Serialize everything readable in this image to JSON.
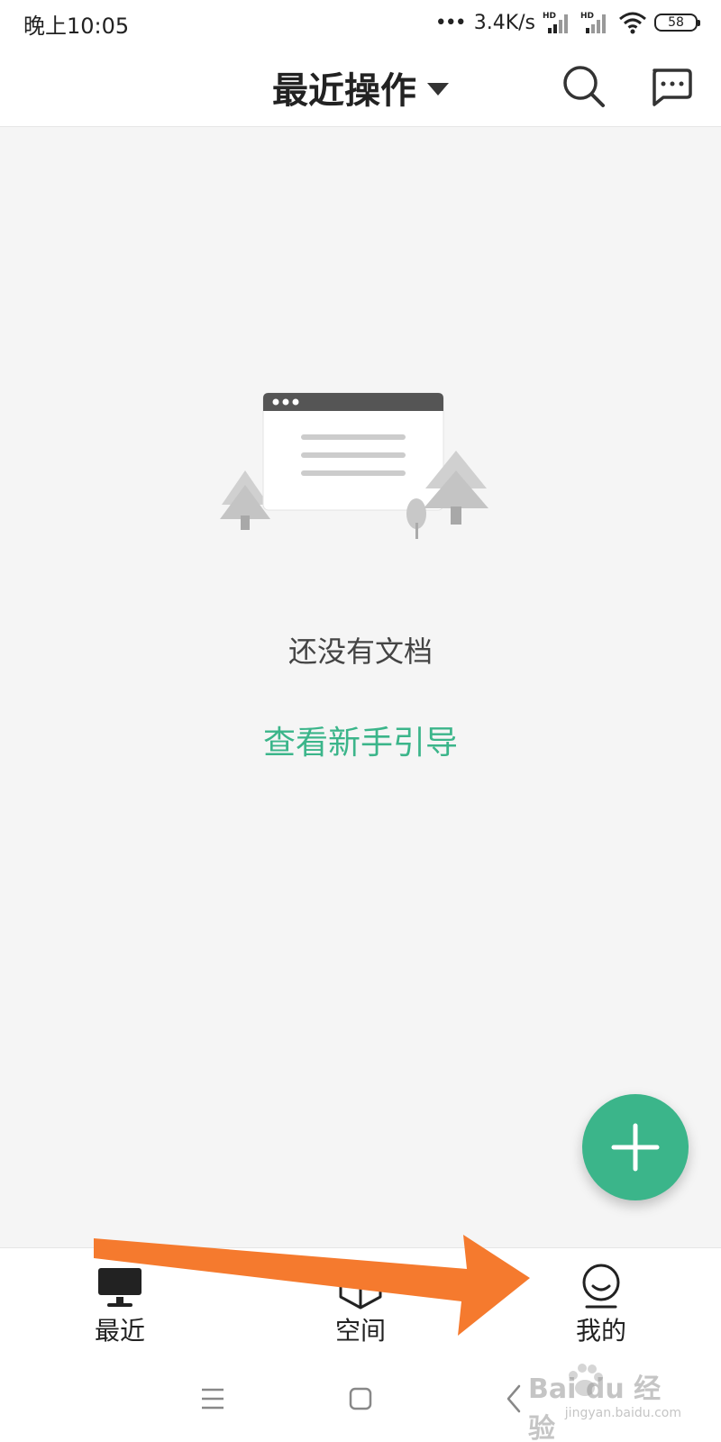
{
  "status_bar": {
    "time": "晚上10:05",
    "network_speed": "3.4K/s",
    "battery": "58",
    "signal_label": "HD"
  },
  "app_bar": {
    "title": "最近操作"
  },
  "empty_state": {
    "message": "还没有文档",
    "guide_link": "查看新手引导"
  },
  "tabs": [
    {
      "label": "最近",
      "icon": "monitor-icon"
    },
    {
      "label": "空间",
      "icon": "cube-icon"
    },
    {
      "label": "我的",
      "icon": "profile-icon"
    }
  ],
  "colors": {
    "accent": "#3bb58a",
    "annotation_arrow": "#f57a2e"
  },
  "watermark": {
    "text": "Bai du 经验",
    "sub": "jingyan.baidu.com"
  }
}
